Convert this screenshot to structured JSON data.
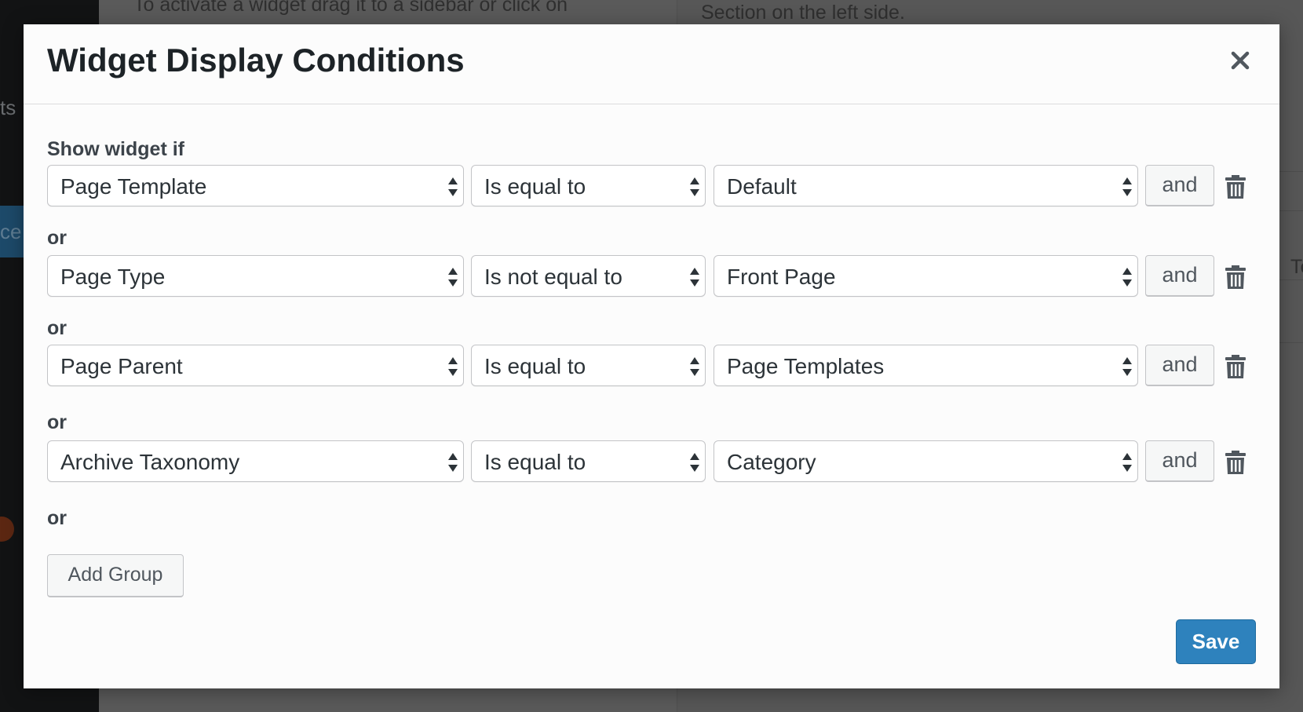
{
  "background": {
    "content_text": "To activate a widget drag it to a sidebar or click on",
    "right_text": "Section on the left side.",
    "sidebar_text_1": "ts",
    "sidebar_text_2": "ce",
    "edge_text": "Te"
  },
  "modal": {
    "title": "Widget Display Conditions",
    "close_glyph": "×",
    "show_label": "Show widget if",
    "or_label": "or",
    "and_label": "and",
    "add_group_label": "Add Group",
    "save_label": "Save"
  },
  "rules": [
    {
      "field": "Page Template",
      "operator": "Is equal to",
      "value": "Default"
    },
    {
      "field": "Page Type",
      "operator": "Is not equal to",
      "value": "Front Page"
    },
    {
      "field": "Page Parent",
      "operator": "Is equal to",
      "value": "Page Templates"
    },
    {
      "field": "Archive Taxonomy",
      "operator": "Is equal to",
      "value": "Category"
    }
  ],
  "colors": {
    "primary": "#2e82bd",
    "title": "#1d2327",
    "border": "#c3c4c7"
  }
}
